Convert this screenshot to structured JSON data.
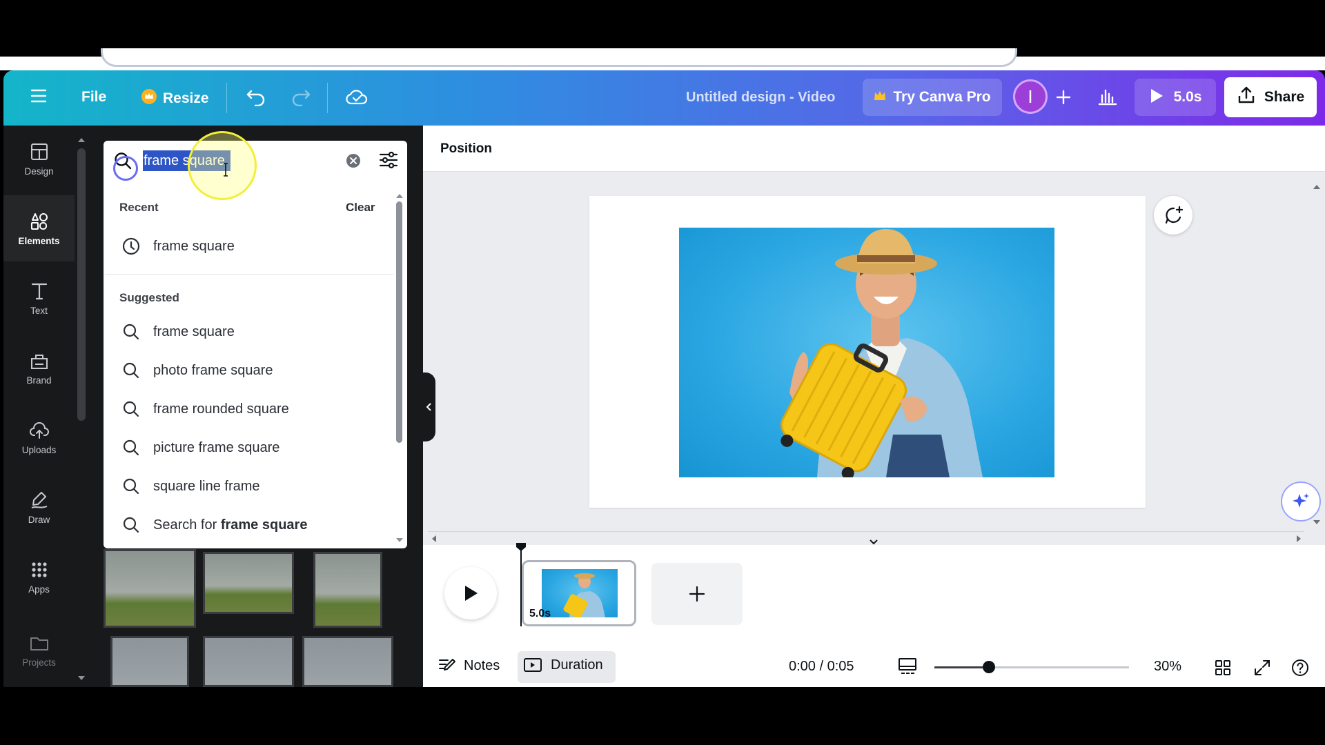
{
  "toolbar": {
    "file_label": "File",
    "resize_label": "Resize",
    "title": "Untitled design - Video",
    "try_pro_label": "Try Canva Pro",
    "avatar_letter": "I",
    "play_duration": "5.0s",
    "share_label": "Share",
    "gradient_start": "#14b5c9",
    "gradient_end": "#7d2ae8"
  },
  "sidebar": {
    "items": [
      {
        "label": "Design",
        "icon": "layout-icon"
      },
      {
        "label": "Elements",
        "icon": "shapes-icon"
      },
      {
        "label": "Text",
        "icon": "text-icon"
      },
      {
        "label": "Brand",
        "icon": "brand-icon"
      },
      {
        "label": "Uploads",
        "icon": "upload-icon"
      },
      {
        "label": "Draw",
        "icon": "draw-icon"
      },
      {
        "label": "Apps",
        "icon": "apps-grid-icon"
      },
      {
        "label": "Projects",
        "icon": "folder-icon"
      }
    ]
  },
  "search": {
    "value": "frame square",
    "recent_heading": "Recent",
    "clear_label": "Clear",
    "recent": [
      "frame square"
    ],
    "suggested_heading": "Suggested",
    "suggested": [
      "frame square",
      "photo frame square",
      "frame rounded square",
      "picture frame square",
      "square line frame"
    ],
    "search_for_prefix": "Search for",
    "search_for_term": "frame square"
  },
  "editor": {
    "position_label": "Position"
  },
  "timeline": {
    "scene_duration": "5.0s"
  },
  "bottombar": {
    "notes_label": "Notes",
    "duration_label": "Duration",
    "time": "0:00 / 0:05",
    "zoom": "30%"
  }
}
